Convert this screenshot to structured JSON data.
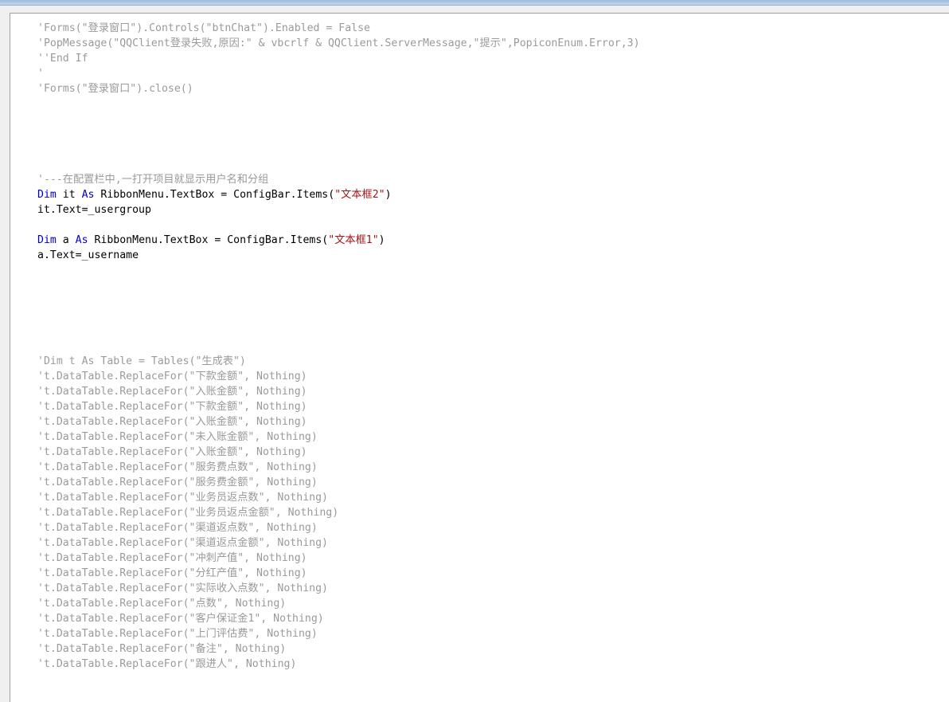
{
  "editor": {
    "lines": [
      {
        "parts": [
          {
            "t": "c",
            "v": "'Forms(\"登录窗口\").Controls(\"btnChat\").Enabled = False"
          }
        ]
      },
      {
        "parts": [
          {
            "t": "c",
            "v": "'PopMessage(\"QQClient登录失败,原因:\" & vbcrlf & QQClient.ServerMessage,\"提示\",PopiconEnum.Error,3)"
          }
        ]
      },
      {
        "parts": [
          {
            "t": "c",
            "v": "''End If"
          }
        ]
      },
      {
        "parts": [
          {
            "t": "c",
            "v": "'"
          }
        ]
      },
      {
        "parts": [
          {
            "t": "c",
            "v": "'Forms(\"登录窗口\").close()"
          }
        ]
      },
      {
        "parts": []
      },
      {
        "parts": []
      },
      {
        "parts": []
      },
      {
        "parts": []
      },
      {
        "parts": []
      },
      {
        "parts": [
          {
            "t": "c",
            "v": "'---在配置栏中,一打开项目就显示用户名和分组"
          }
        ]
      },
      {
        "parts": [
          {
            "t": "k",
            "v": "Dim"
          },
          {
            "t": "p",
            "v": " it "
          },
          {
            "t": "k",
            "v": "As"
          },
          {
            "t": "p",
            "v": " RibbonMenu.TextBox = ConfigBar.Items("
          },
          {
            "t": "s",
            "v": "\"文本框2\""
          },
          {
            "t": "p",
            "v": ")"
          }
        ]
      },
      {
        "parts": [
          {
            "t": "p",
            "v": "it.Text=_usergroup"
          }
        ]
      },
      {
        "parts": []
      },
      {
        "parts": [
          {
            "t": "k",
            "v": "Dim"
          },
          {
            "t": "p",
            "v": " a "
          },
          {
            "t": "k",
            "v": "As"
          },
          {
            "t": "p",
            "v": " RibbonMenu.TextBox = ConfigBar.Items("
          },
          {
            "t": "s",
            "v": "\"文本框1\""
          },
          {
            "t": "p",
            "v": ")"
          }
        ]
      },
      {
        "parts": [
          {
            "t": "p",
            "v": "a.Text=_username"
          }
        ]
      },
      {
        "parts": []
      },
      {
        "parts": []
      },
      {
        "parts": []
      },
      {
        "parts": []
      },
      {
        "parts": []
      },
      {
        "parts": []
      },
      {
        "parts": [
          {
            "t": "c",
            "v": "'Dim t As Table = Tables(\"生成表\")"
          }
        ]
      },
      {
        "parts": [
          {
            "t": "c",
            "v": "'t.DataTable.ReplaceFor(\"下款金额\", Nothing)"
          }
        ]
      },
      {
        "parts": [
          {
            "t": "c",
            "v": "'t.DataTable.ReplaceFor(\"入账金额\", Nothing)"
          }
        ]
      },
      {
        "parts": [
          {
            "t": "c",
            "v": "'t.DataTable.ReplaceFor(\"下款金额\", Nothing)"
          }
        ]
      },
      {
        "parts": [
          {
            "t": "c",
            "v": "'t.DataTable.ReplaceFor(\"入账金额\", Nothing)"
          }
        ]
      },
      {
        "parts": [
          {
            "t": "c",
            "v": "'t.DataTable.ReplaceFor(\"未入账金额\", Nothing)"
          }
        ]
      },
      {
        "parts": [
          {
            "t": "c",
            "v": "'t.DataTable.ReplaceFor(\"入账金额\", Nothing)"
          }
        ]
      },
      {
        "parts": [
          {
            "t": "c",
            "v": "'t.DataTable.ReplaceFor(\"服务费点数\", Nothing)"
          }
        ]
      },
      {
        "parts": [
          {
            "t": "c",
            "v": "'t.DataTable.ReplaceFor(\"服务费金额\", Nothing)"
          }
        ]
      },
      {
        "parts": [
          {
            "t": "c",
            "v": "'t.DataTable.ReplaceFor(\"业务员返点数\", Nothing)"
          }
        ]
      },
      {
        "parts": [
          {
            "t": "c",
            "v": "'t.DataTable.ReplaceFor(\"业务员返点金额\", Nothing)"
          }
        ]
      },
      {
        "parts": [
          {
            "t": "c",
            "v": "'t.DataTable.ReplaceFor(\"渠道返点数\", Nothing)"
          }
        ]
      },
      {
        "parts": [
          {
            "t": "c",
            "v": "'t.DataTable.ReplaceFor(\"渠道返点金额\", Nothing)"
          }
        ]
      },
      {
        "parts": [
          {
            "t": "c",
            "v": "'t.DataTable.ReplaceFor(\"冲刺产值\", Nothing)"
          }
        ]
      },
      {
        "parts": [
          {
            "t": "c",
            "v": "'t.DataTable.ReplaceFor(\"分红产值\", Nothing)"
          }
        ]
      },
      {
        "parts": [
          {
            "t": "c",
            "v": "'t.DataTable.ReplaceFor(\"实际收入点数\", Nothing)"
          }
        ]
      },
      {
        "parts": [
          {
            "t": "c",
            "v": "'t.DataTable.ReplaceFor(\"点数\", Nothing)"
          }
        ]
      },
      {
        "parts": [
          {
            "t": "c",
            "v": "'t.DataTable.ReplaceFor(\"客户保证金1\", Nothing)"
          }
        ]
      },
      {
        "parts": [
          {
            "t": "c",
            "v": "'t.DataTable.ReplaceFor(\"上门评估费\", Nothing)"
          }
        ]
      },
      {
        "parts": [
          {
            "t": "c",
            "v": "'t.DataTable.ReplaceFor(\"备注\", Nothing)"
          }
        ]
      },
      {
        "parts": [
          {
            "t": "c",
            "v": "'t.DataTable.ReplaceFor(\"跟进人\", Nothing)"
          }
        ]
      }
    ]
  }
}
